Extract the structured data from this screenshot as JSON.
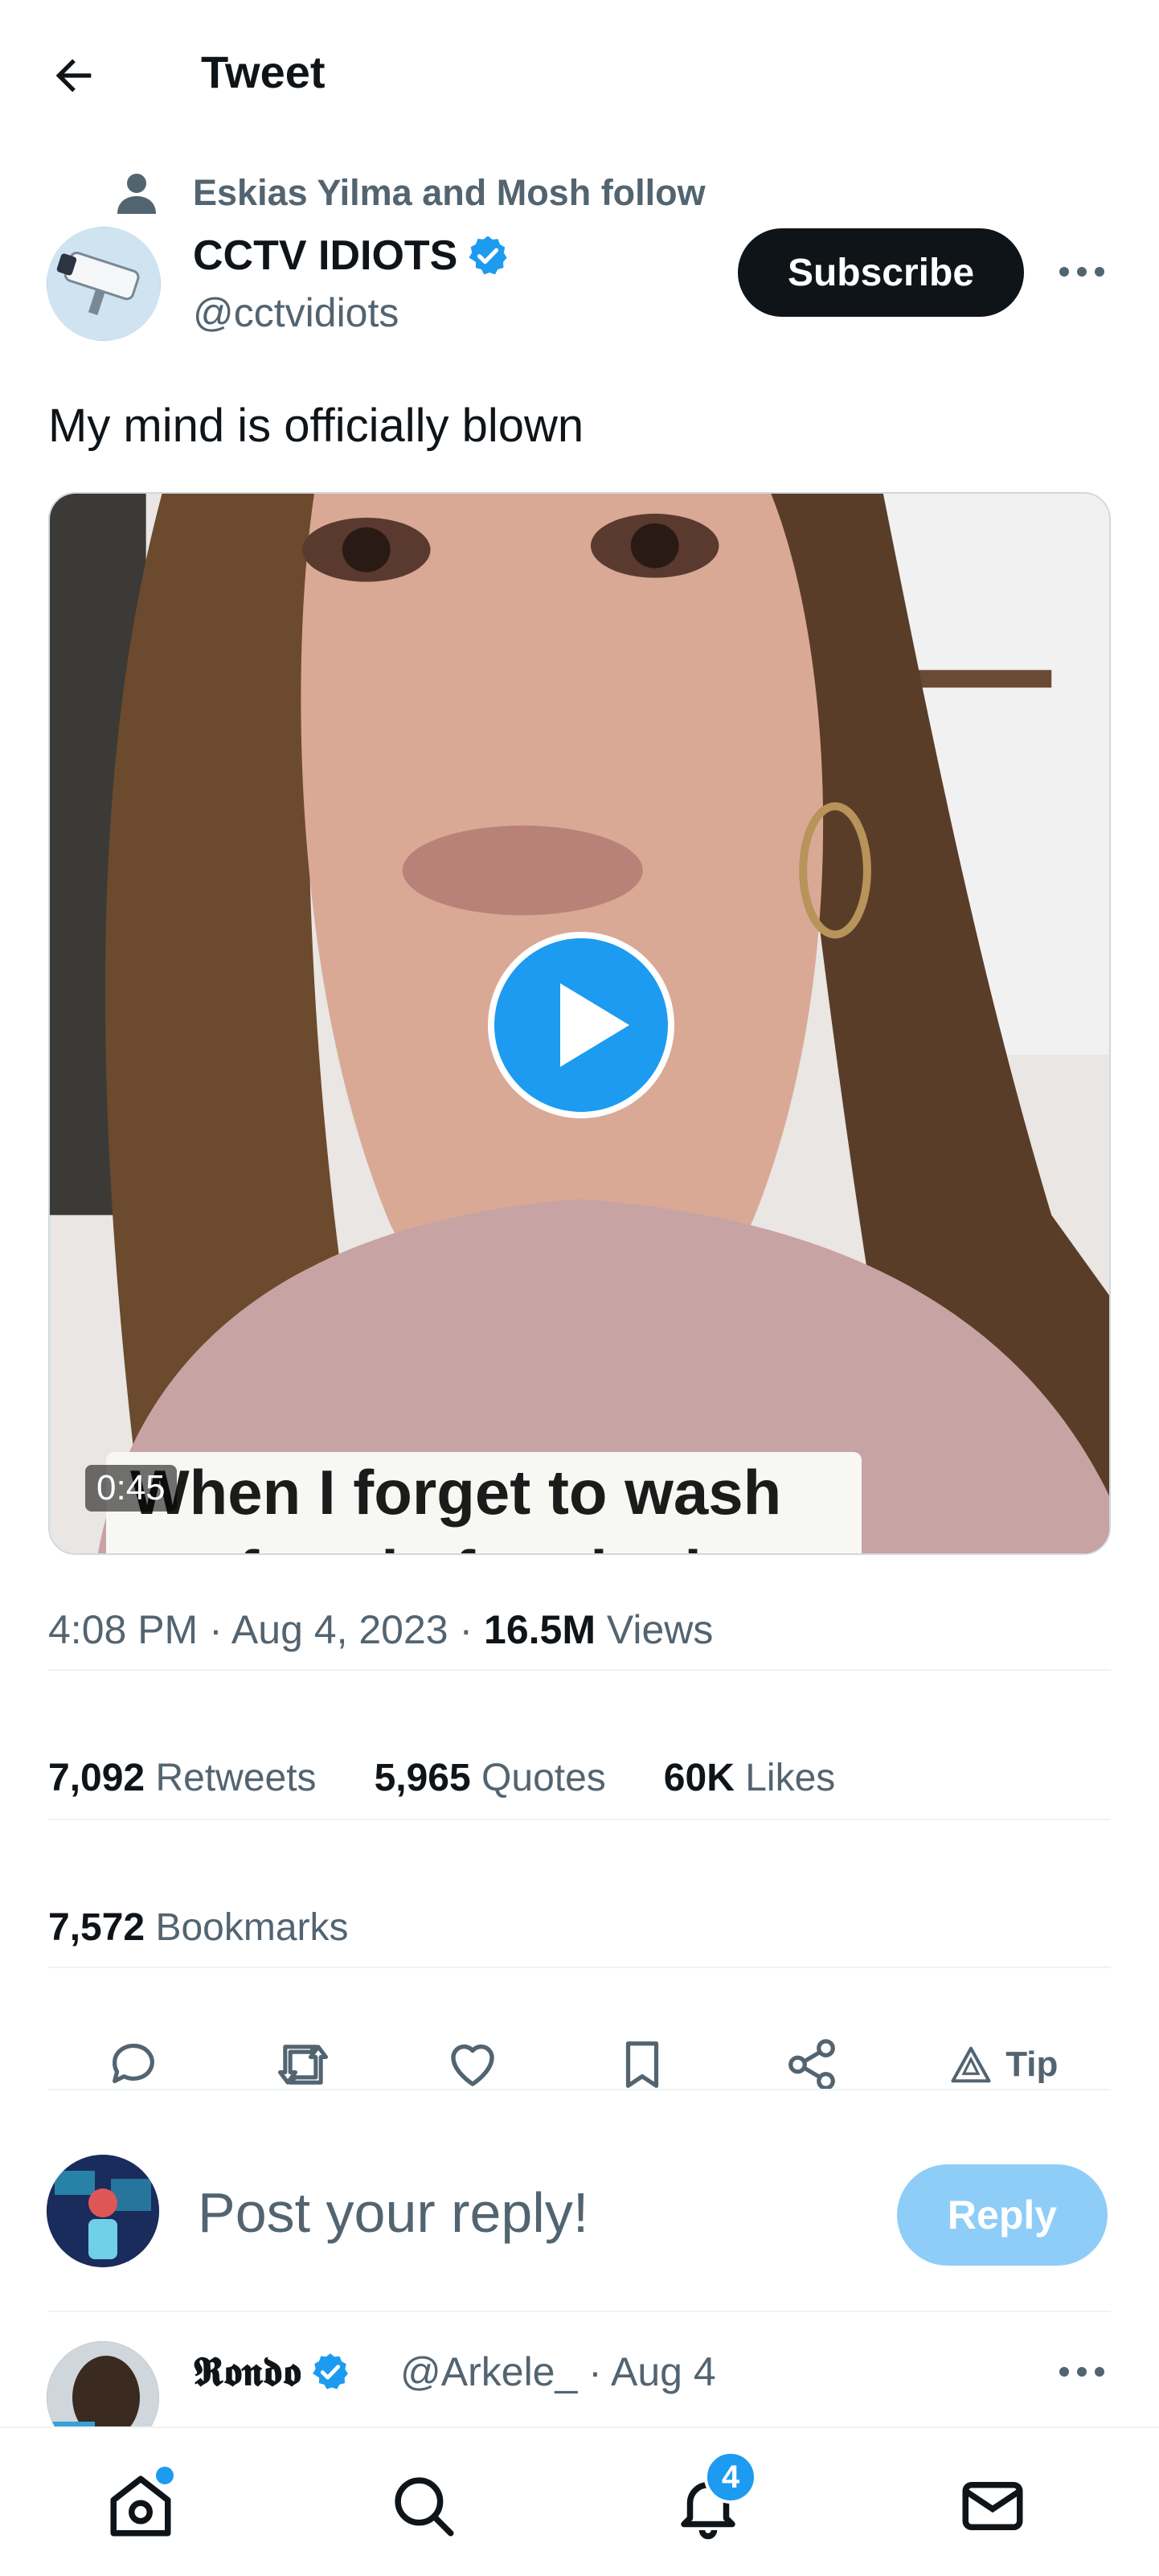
{
  "header": {
    "title": "Tweet",
    "back_icon": "arrow-left-icon"
  },
  "social_context": {
    "text": "Eskias Yilma and Mosh follow",
    "icon": "person-icon"
  },
  "author": {
    "name": "CCTV IDIOTS",
    "handle": "@cctvidiots",
    "verified": true,
    "subscribe_label": "Subscribe",
    "more_icon": "more-horizontal-icon"
  },
  "tweet": {
    "text": "My mind is officially blown",
    "media": {
      "type": "video",
      "duration": "0:45",
      "caption_line": "When I forget to wash",
      "caption_partial": "my face before bed"
    },
    "time": "4:08 PM",
    "date": "Aug 4, 2023",
    "views_count": "16.5M",
    "views_label": "Views"
  },
  "stats": {
    "retweets_count": "7,092",
    "retweets_label": "Retweets",
    "quotes_count": "5,965",
    "quotes_label": "Quotes",
    "likes_count": "60K",
    "likes_label": "Likes",
    "bookmarks_count": "7,572",
    "bookmarks_label": "Bookmarks"
  },
  "actions": {
    "icons": [
      "reply-icon",
      "retweet-icon",
      "like-icon",
      "bookmark-icon",
      "share-icon",
      "tip-icon"
    ],
    "tip_label": "Tip"
  },
  "reply_composer": {
    "placeholder": "Post your reply!",
    "button_label": "Reply"
  },
  "next_reply": {
    "name": "𝕽𝖔𝖓𝖉𝖔",
    "handle_date": "@Arkele_ · Aug 4",
    "verified": true
  },
  "bottom_nav": {
    "items": [
      "home-icon",
      "search-icon",
      "notifications-icon",
      "messages-icon"
    ],
    "notification_badge": "4"
  },
  "colors": {
    "accent": "#1d9bf0",
    "text": "#0f1419",
    "muted": "#536471",
    "reply_disabled": "#8ecdf8"
  }
}
